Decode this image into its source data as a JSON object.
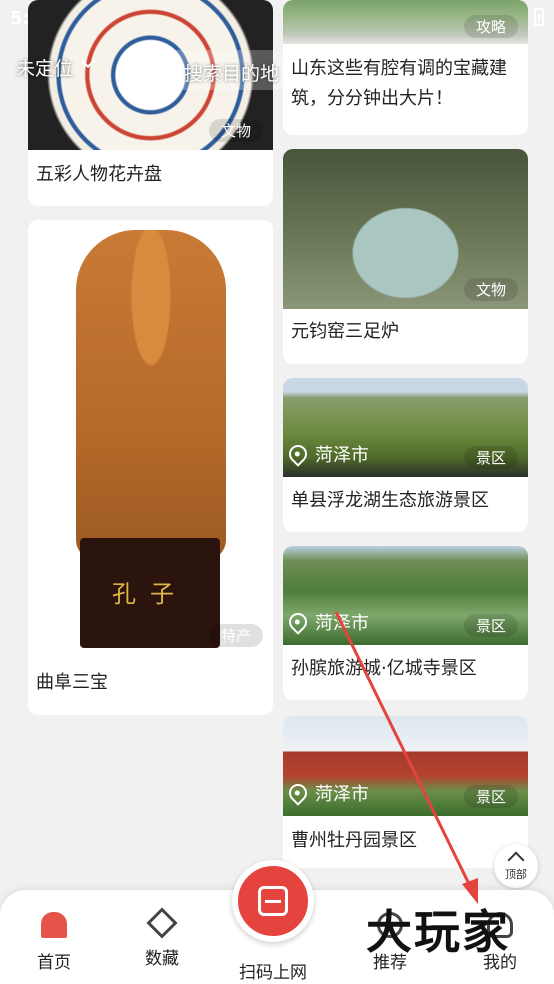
{
  "status_bar": {
    "time": "5:"
  },
  "topbar": {
    "location": "未定位",
    "search_placeholder": "搜索目的地"
  },
  "cards": [
    {
      "title": "五彩人物花卉盘",
      "tag": "文物",
      "image": "plate-image"
    },
    {
      "title": "山东这些有腔有调的宝藏建筑，分分钟出大片！",
      "tag": "攻略",
      "image": "wall-image"
    },
    {
      "title": "元钧窑三足炉",
      "tag": "文物",
      "image": "incense-burner-image"
    },
    {
      "title": "曲阜三宝",
      "tag": "特产",
      "image": "statue-image",
      "pedestal_text": "孔子"
    },
    {
      "title": "单县浮龙湖生态旅游景区",
      "tag": "景区",
      "city": "菏泽市",
      "image": "lake-image"
    },
    {
      "title": "孙膑旅游城·亿城寺景区",
      "tag": "景区",
      "city": "菏泽市",
      "image": "park-image"
    },
    {
      "title": "曹州牡丹园景区",
      "tag": "景区",
      "city": "菏泽市",
      "image": "tower-image"
    }
  ],
  "back_to_top": "顶部",
  "bottom_nav": {
    "home": "首页",
    "collect": "数藏",
    "scan": "扫码上网",
    "recommend": "推荐",
    "mine": "我的"
  },
  "watermark": "大玩家",
  "colors": {
    "accent": "#e5433d",
    "background": "#f1f1f1"
  }
}
